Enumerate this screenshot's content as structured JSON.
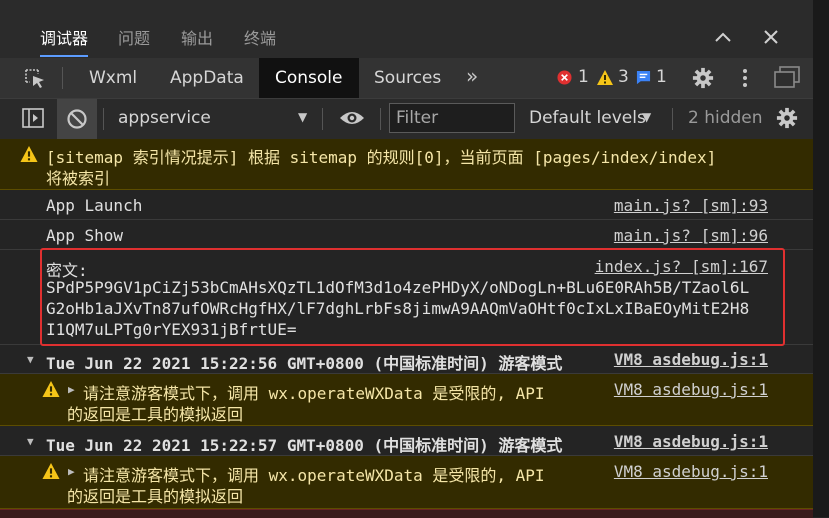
{
  "panel_tabs": [
    "调试器",
    "问题",
    "输出",
    "终端"
  ],
  "panel_controls": {
    "collapse_icon": "chevron-up-icon",
    "close_icon": "close-icon"
  },
  "devtools_tabs": [
    "Wxml",
    "AppData",
    "Console",
    "Sources"
  ],
  "active_devtools_tab": "Console",
  "counts": {
    "errors": "1",
    "warnings": "3",
    "info": "1"
  },
  "toolbar": {
    "context": "appservice",
    "filter_placeholder": "Filter",
    "levels": "Default levels",
    "hidden": "2 hidden"
  },
  "messages": [
    {
      "level": "warning",
      "lines": [
        "[sitemap 索引情况提示] 根据 sitemap 的规则[0]，当前页面 [pages/index/index]",
        "将被索引"
      ]
    },
    {
      "level": "log",
      "text": "App Launch",
      "source": "main.js? [sm]:93"
    },
    {
      "level": "log",
      "text": "App Show",
      "source": "main.js? [sm]:96"
    },
    {
      "level": "log",
      "label": "密文:",
      "source": "index.js? [sm]:167",
      "lines": [
        "SPdP5P9GV1pCiZj53bCmAHsXQzTL1dOfM3d1o4zePHDyX/oNDogLn+BLu6E0RAh5B/TZaol6L",
        "G2oHb1aJXvTn87ufOWRcHgfHX/lF7dghLrbFs8jimwA9AAQmVaOHtf0cIxLxIBaEOyMitE2H8",
        "I1QM7uLPTg0rYEX931jBfrtUE="
      ]
    },
    {
      "level": "group",
      "text": "Tue Jun 22 2021 15:22:56 GMT+0800 (中国标准时间) 游客模式",
      "source": "VM8 asdebug.js:1"
    },
    {
      "level": "warning",
      "lines": [
        "请注意游客模式下，调用 wx.operateWXData 是受限的, API",
        "的返回是工具的模拟返回"
      ],
      "source": "VM8 asdebug.js:1"
    },
    {
      "level": "group",
      "text": "Tue Jun 22 2021 15:22:57 GMT+0800 (中国标准时间) 游客模式",
      "source": "VM8 asdebug.js:1"
    },
    {
      "level": "warning",
      "lines": [
        "请注意游客模式下，调用 wx.operateWXData 是受限的, API",
        "的返回是工具的模拟返回"
      ],
      "source": "VM8 asdebug.js:1"
    }
  ],
  "colors": {
    "accent": "#5c9cff",
    "error": "#e03030",
    "warning": "#f5c518",
    "info": "#3b82f6"
  }
}
